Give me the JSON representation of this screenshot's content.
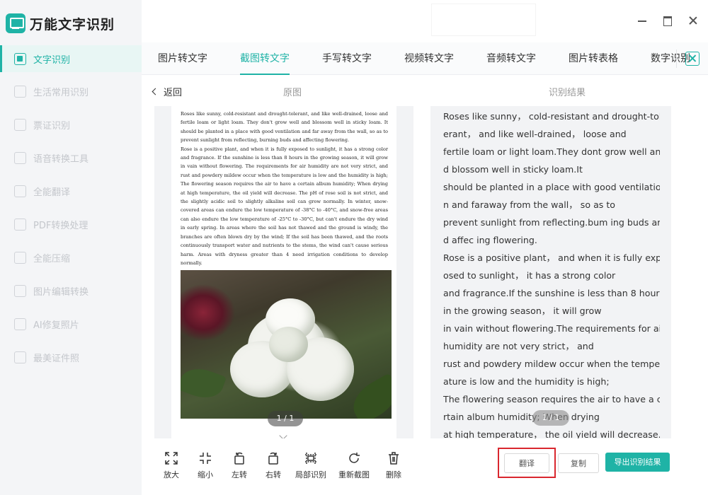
{
  "app": {
    "name": "万能文字识别"
  },
  "sidebar": {
    "items": [
      {
        "label": "文字识别",
        "icon": "text-recognition-icon",
        "active": true
      },
      {
        "label": "生活常用识别",
        "icon": "life-scan-icon"
      },
      {
        "label": "票证识别",
        "icon": "ticket-scan-icon"
      },
      {
        "label": "语音转换工具",
        "icon": "voice-convert-icon"
      },
      {
        "label": "全能翻译",
        "icon": "translate-icon"
      },
      {
        "label": "PDF转换处理",
        "icon": "pdf-icon"
      },
      {
        "label": "全能压缩",
        "icon": "compress-icon"
      },
      {
        "label": "图片编辑转换",
        "icon": "image-edit-icon"
      },
      {
        "label": "AI修复照片",
        "icon": "ai-repair-icon"
      },
      {
        "label": "最美证件照",
        "icon": "id-photo-icon"
      }
    ]
  },
  "tabs": [
    {
      "label": "图片转文字"
    },
    {
      "label": "截图转文字",
      "active": true
    },
    {
      "label": "手写转文字"
    },
    {
      "label": "视频转文字"
    },
    {
      "label": "音频转文字"
    },
    {
      "label": "图片转表格"
    },
    {
      "label": "数字识别"
    }
  ],
  "subheader": {
    "back_label": "返回",
    "original_title": "原图",
    "result_title": "识别结果"
  },
  "document": {
    "paragraphs": [
      "Roses like sunny, cold-resistant and drought-tolerant, and like well-drained, loose and fertile loam or light loam. They don't grow well and blossom well in sticky loam. It should be planted in a place with good ventilation and far away from the wall, so as to prevent sunlight from reflecting, burning buds and affecting flowering.",
      "Rose is a positive plant, and when it is fully exposed to sunlight, it has a strong color and fragrance. If the sunshine is less than 8 hours in the growing season, it will grow in vain without flowering. The requirements for air humidity are not very strict, and rust and powdery mildew occur when the temperature is low and the humidity is high; The flowering season requires the air to have a certain album humidity; When drying at high temperature, the oil yield will decrease. The pH of rose soil is not strict, and the slightly acidic soil to slightly alkaline soil can grow normally. In winter, snow-covered areas can endure the low temperature of -38°C to -40°C, and snow-free areas can also endure the low temperature of -25°C to -30°C, but can't endure the dry wind in early spring. In areas where the soil has not thawed and the ground is windy, the branches are often blown dry by the wind; If the soil has been thawed, and the roots continuously transport water and nutrients to the stems, the wind can't cause serious harm. Areas with dryness greater than 4 need irrigation conditions to develop normally."
    ],
    "page_indicator": "1 / 1"
  },
  "result": {
    "lines": [
      "Roses like sunny， cold-resistant and drought-tol",
      "erant， and like well-drained， loose and",
      "fertile loam or light loam.They dont grow well an",
      "d blossom well in sticky loam.It",
      "should be planted in a place with good ventilatio",
      "n and faraway from the wall， so as to",
      "prevent sunlight from reflecting.bum ing buds an",
      "d affec ing flowering.",
      "Rose is a positive plant， and when it is fully exp",
      "osed to sunlight， it has a strong color",
      "and fragrance.If the sunshine is less than 8 hours",
      " in the growing season， it will grow",
      "in vain without flowering.The requirements for air",
      "humidity are not very strict， and",
      "rust and powdery mildew occur when the temper",
      "ature is low and the humidity is high;",
      "The flowering season requires the air to have a ce",
      "rtain album humidity; When drying",
      "at high temperature， the oil yield will decrease.T"
    ],
    "page_indicator": "1 / 1"
  },
  "toolbar": {
    "tools": [
      {
        "label": "放大",
        "icon": "zoom-in-icon"
      },
      {
        "label": "缩小",
        "icon": "zoom-out-icon"
      },
      {
        "label": "左转",
        "icon": "rotate-left-icon"
      },
      {
        "label": "右转",
        "icon": "rotate-right-icon"
      },
      {
        "label": "局部识别",
        "icon": "partial-recognize-icon"
      },
      {
        "label": "重新截图",
        "icon": "rescreenshot-icon"
      },
      {
        "label": "删除",
        "icon": "delete-icon"
      }
    ]
  },
  "actions": {
    "translate_label": "翻译",
    "copy_label": "复制",
    "export_label": "导出识别结果"
  },
  "colors": {
    "accent": "#1fb3a6",
    "highlight": "#d9272e"
  }
}
